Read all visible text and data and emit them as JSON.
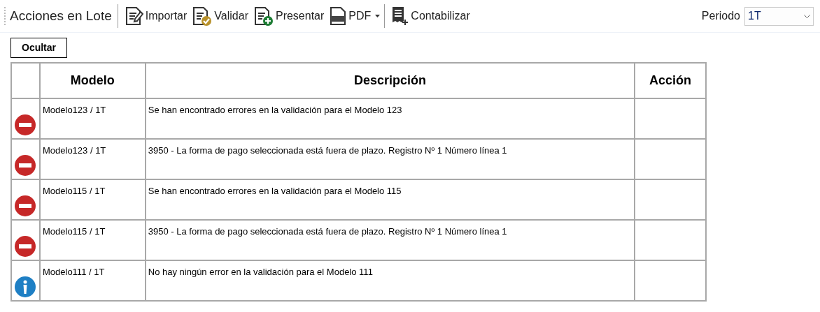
{
  "toolbar": {
    "title": "Acciones en Lote",
    "buttons": [
      {
        "kind": "import",
        "label": "Importar",
        "dropdown": false
      },
      {
        "kind": "validate",
        "label": "Validar",
        "dropdown": false
      },
      {
        "kind": "submit",
        "label": "Presentar",
        "dropdown": false
      },
      {
        "kind": "pdf",
        "label": "PDF",
        "dropdown": true
      },
      {
        "kind": "ledger",
        "label": "Contabilizar",
        "dropdown": false
      }
    ],
    "period": {
      "label": "Periodo",
      "value": "1T"
    }
  },
  "hide_button": "Ocultar",
  "table": {
    "columns": [
      "Modelo",
      "Descripción",
      "Acción"
    ],
    "rows": [
      {
        "kind": "error",
        "model": "Modelo123 / 1T",
        "description": "Se han encontrado errores en la validación para el Modelo 123"
      },
      {
        "kind": "error",
        "model": "Modelo123 / 1T",
        "description": "3950 - La forma de pago seleccionada está fuera de plazo. Registro Nº 1 Número línea 1"
      },
      {
        "kind": "error",
        "model": "Modelo115 / 1T",
        "description": "Se han encontrado errores en la validación para el Modelo 115"
      },
      {
        "kind": "error",
        "model": "Modelo115 / 1T",
        "description": "3950 - La forma de pago seleccionada está fuera de plazo. Registro Nº 1 Número línea 1"
      },
      {
        "kind": "info",
        "model": "Modelo111 / 1T",
        "description": "No hay ningún error en la validación para el Modelo 111"
      }
    ]
  }
}
